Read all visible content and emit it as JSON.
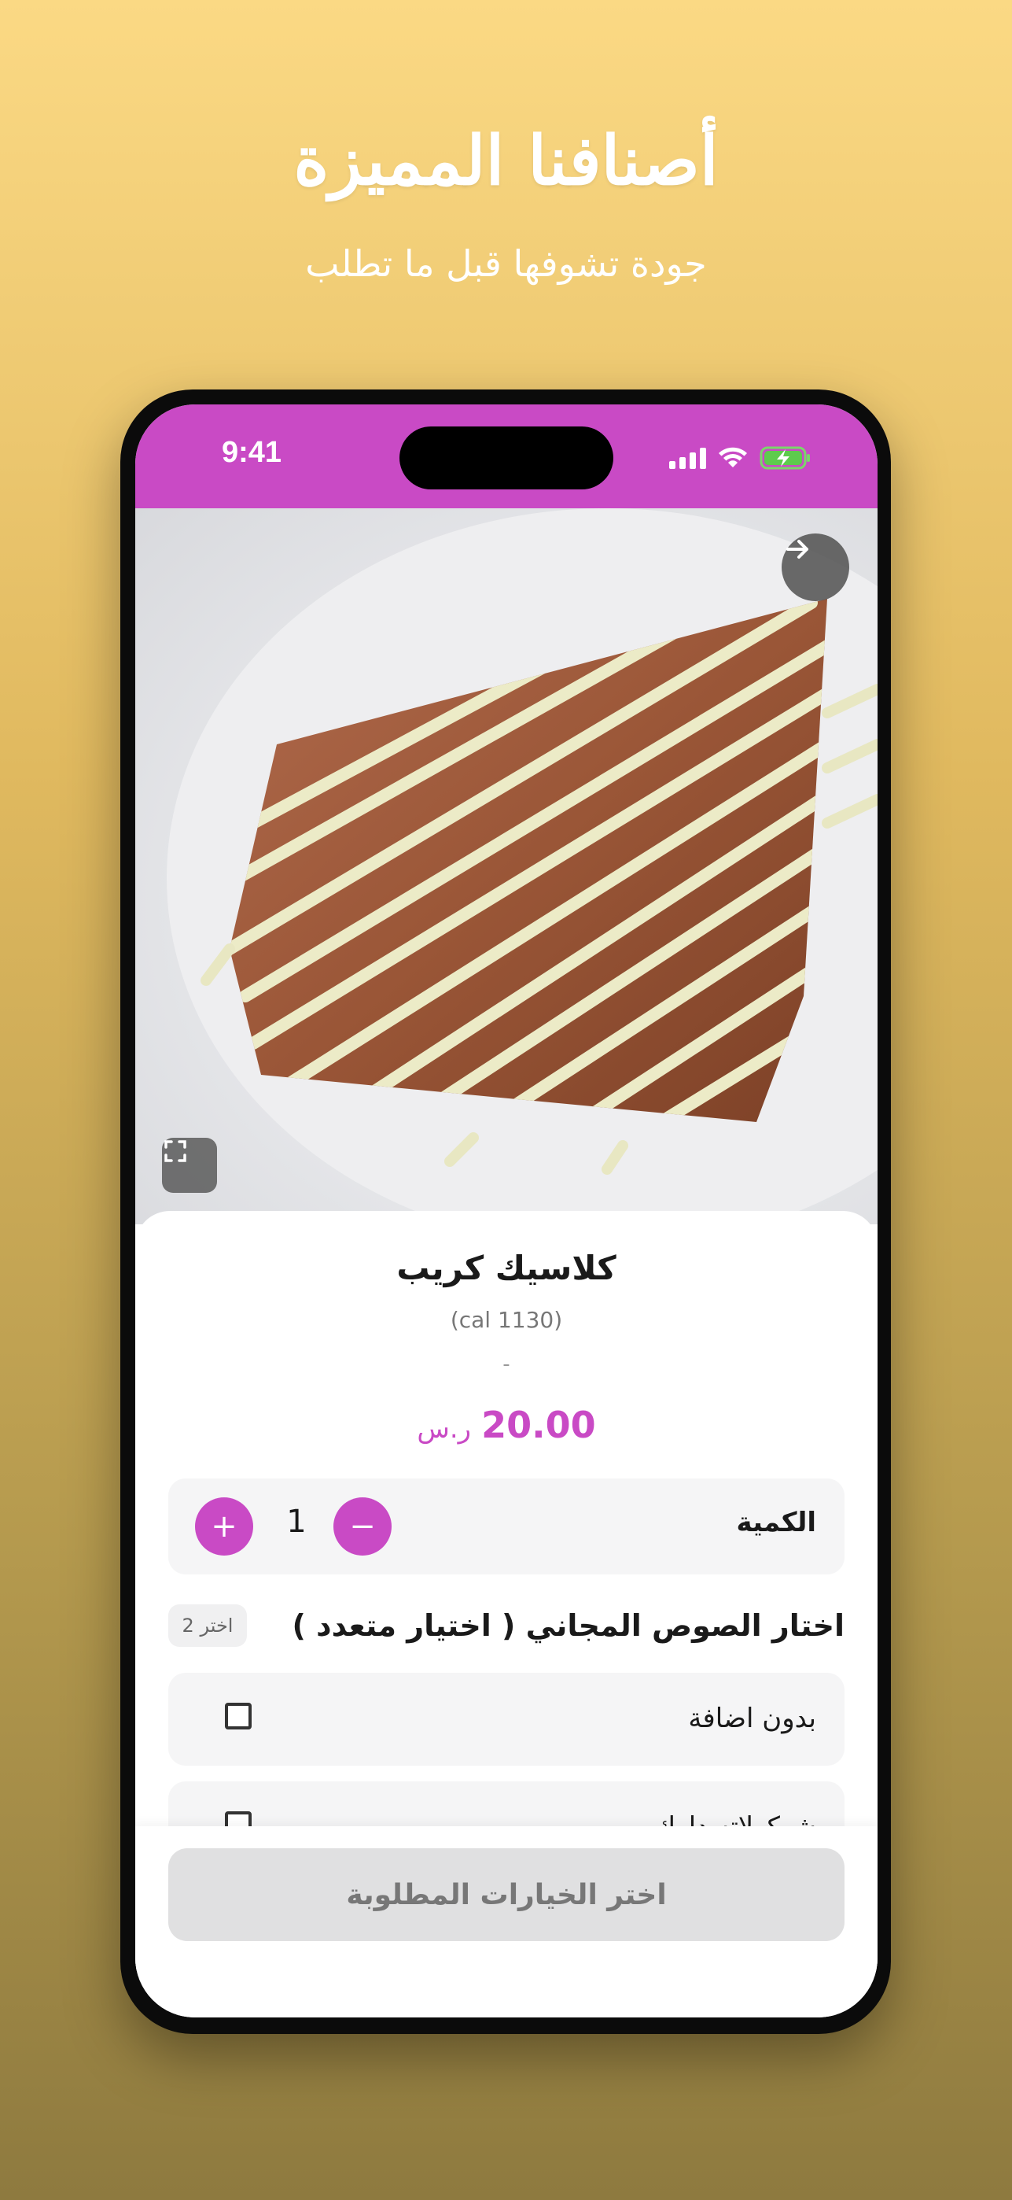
{
  "promo": {
    "title": "أصنافنا المميزة",
    "subtitle": "جودة تشوفها قبل ما تطلب"
  },
  "status_bar": {
    "time": "9:41",
    "icons": [
      "signal-icon",
      "wifi-icon",
      "battery-charging-icon"
    ],
    "background": "#c94ac5"
  },
  "image_controls": {
    "back_icon": "arrow-right-icon",
    "expand_icon": "expand-icon"
  },
  "product": {
    "name": "كلاسيك كريب",
    "calories": "(cal 1130)",
    "description": "-",
    "price": "20.00",
    "currency": "ر.س"
  },
  "quantity": {
    "label": "الكمية",
    "value": "1",
    "plus": "+",
    "minus": "−"
  },
  "options_section": {
    "title": "اختار الصوص المجاني ( اختيار متعدد )",
    "badge": "اختر 2",
    "items": [
      {
        "label": "بدون اضافة",
        "checked": false
      },
      {
        "label": "شوكولاته دارك",
        "checked": false
      }
    ]
  },
  "footer": {
    "cta_label": "اختر الخيارات المطلوبة"
  },
  "colors": {
    "accent": "#c94ac5",
    "background_top": "#fbd984",
    "background_bottom": "#8e7a3f"
  }
}
